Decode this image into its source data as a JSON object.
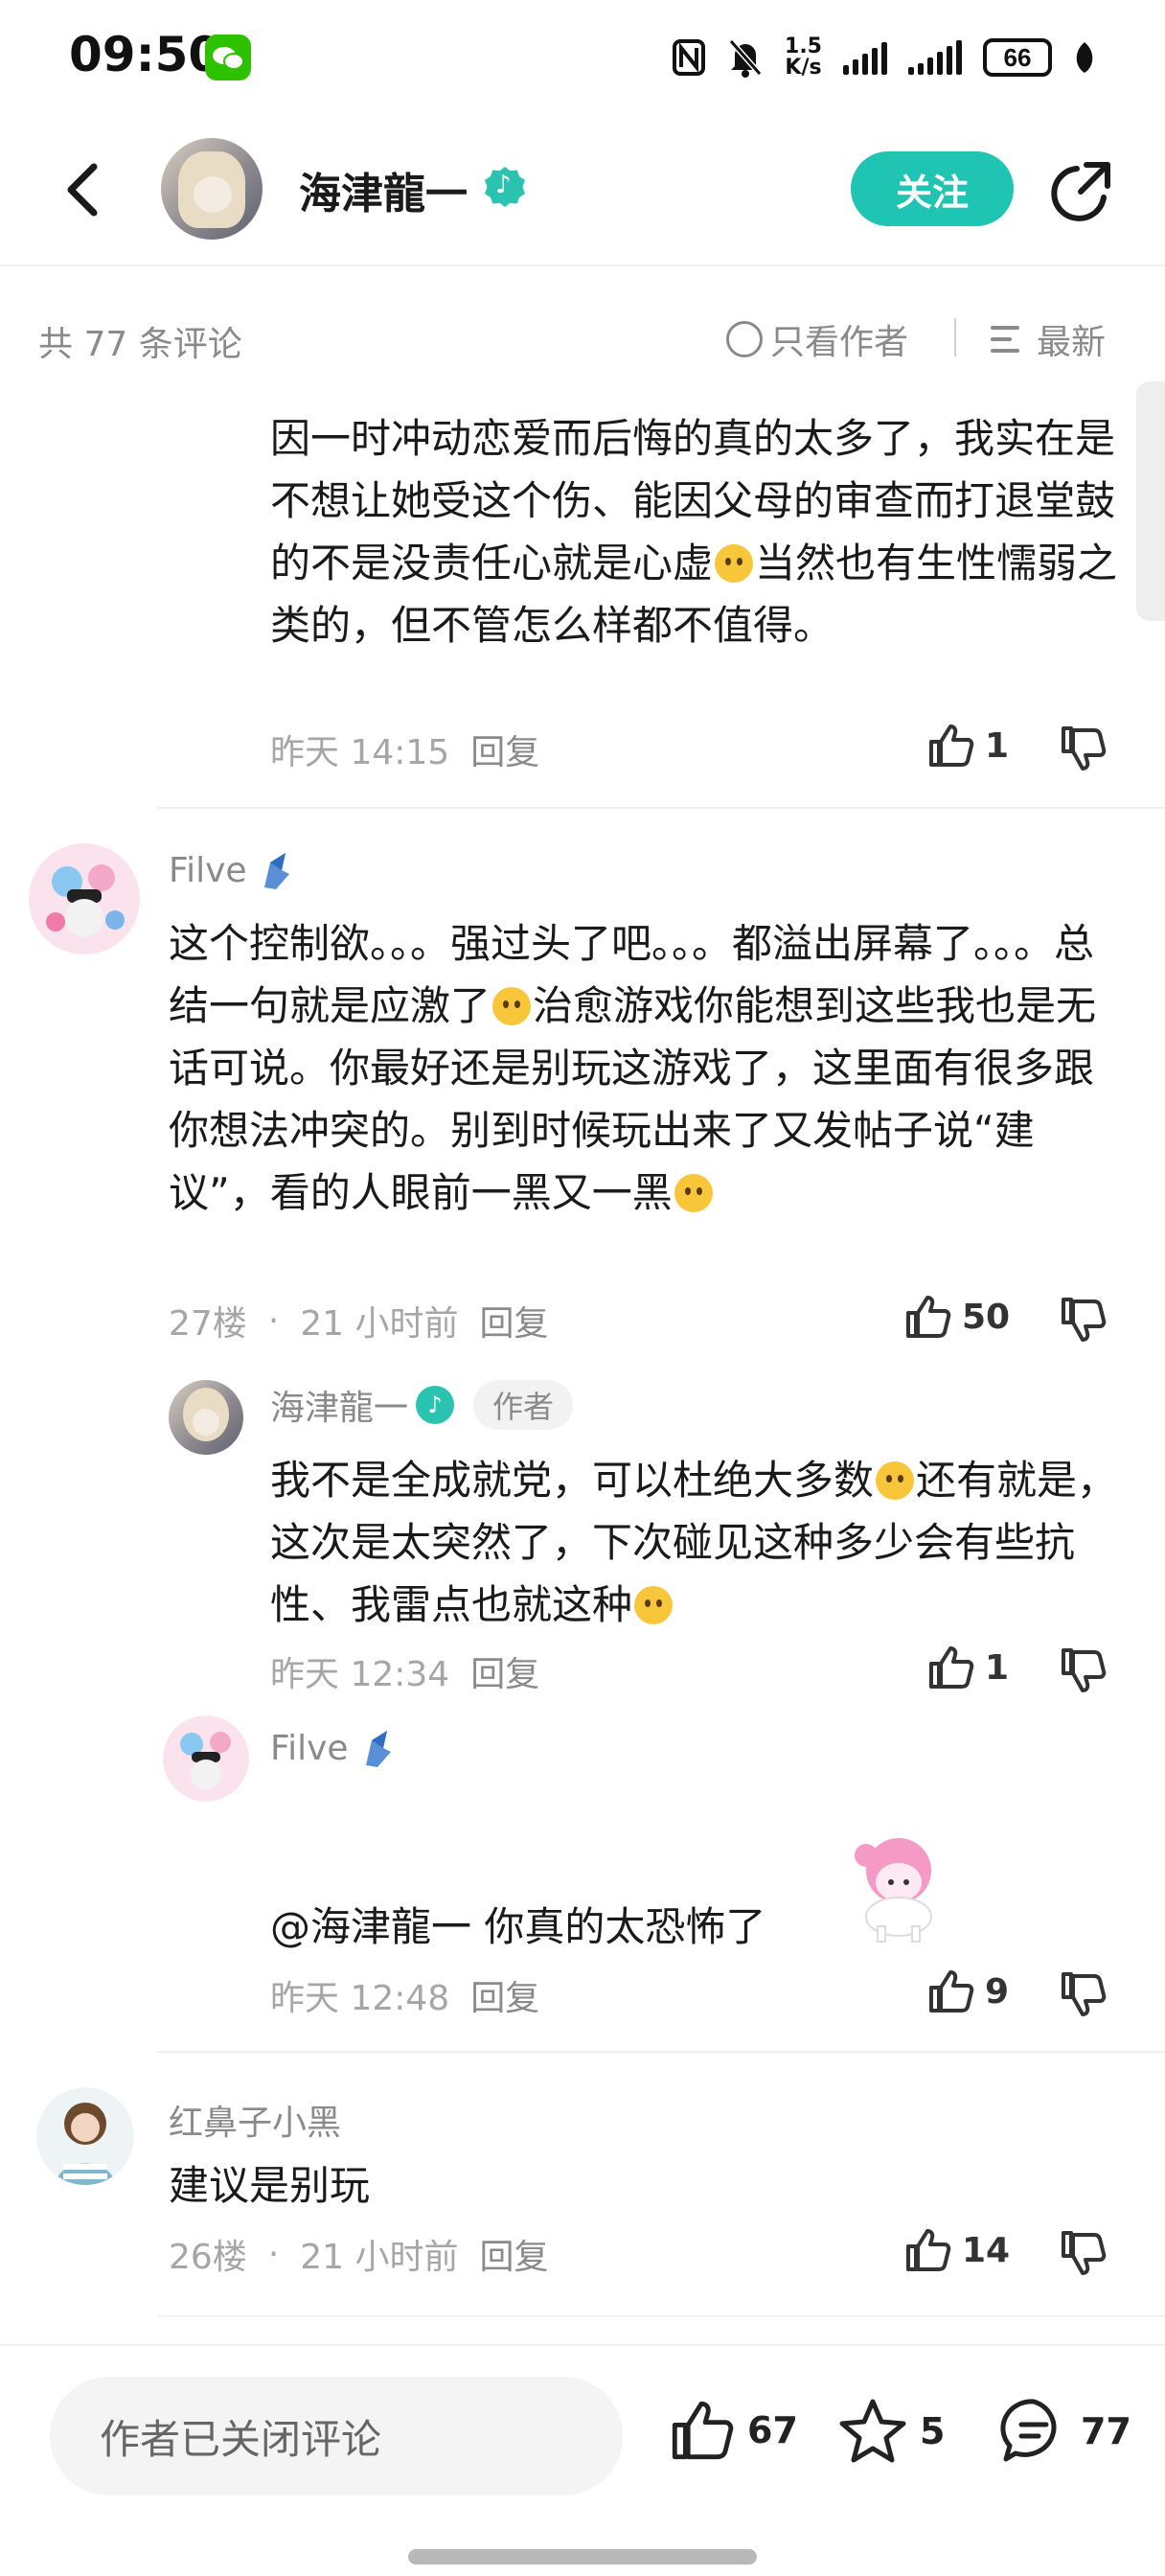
{
  "status_bar": {
    "time": "09:50",
    "net_speed_value": "1.5",
    "net_speed_unit": "K/s",
    "battery": "66"
  },
  "header": {
    "author_name": "海津龍一",
    "follow_label": "关注"
  },
  "sort_bar": {
    "count_text": "共 77 条评论",
    "author_only_label": "只看作者",
    "sort_label": "最新"
  },
  "comments": [
    {
      "text_a": "因一时冲动恋爱而后悔的真的太多了，我实在是不想让她受这个伤、能因父母的审查而打退堂鼓的不是没责任心就是心虚",
      "text_b": "当然也有生性懦弱之类的，但不管怎么样都不值得。",
      "time": "昨天 14:15",
      "reply_label": "回复",
      "likes": "1"
    },
    {
      "username": "Filve",
      "text_a": "这个控制欲。。。强过头了吧。。。都溢出屏幕了。。。总结一句就是应激了",
      "text_b": "治愈游戏你能想到这些我也是无话可说。你最好还是别玩这游戏了，这里面有很多跟你想法冲突的。别到时候玩出来了又发帖子说“建议”，看的人眼前一黑又一黑",
      "floor": "27楼",
      "time": "21 小时前",
      "reply_label": "回复",
      "likes": "50",
      "replies": [
        {
          "username": "海津龍一",
          "tag": "作者",
          "text_a": "我不是全成就党，可以杜绝大多数",
          "text_b": "还有就是，这次是太突然了，下次碰见这种多少会有些抗性、我雷点也就这种",
          "time": "昨天 12:34",
          "reply_label": "回复",
          "likes": "1"
        },
        {
          "username": "Filve",
          "text": "@海津龍一  你真的太恐怖了",
          "time": "昨天 12:48",
          "reply_label": "回复",
          "likes": "9"
        }
      ]
    },
    {
      "username": "红鼻子小黑",
      "text": "建议是别玩",
      "floor": "26楼",
      "time": "21 小时前",
      "reply_label": "回复",
      "likes": "14"
    }
  ],
  "bottom_bar": {
    "input_placeholder": "作者已关闭评论",
    "like_count": "67",
    "star_count": "5",
    "comment_count": "77"
  },
  "colors": {
    "accent": "#1fc4b3",
    "muted_text": "#8a8a8a",
    "verify_badge": "#2ac3b0"
  },
  "icons": [
    "back-icon",
    "share-icon",
    "thumb-up-icon",
    "thumb-down-icon",
    "star-icon",
    "comment-icon",
    "verify-badge-icon",
    "wechat-icon",
    "nfc-icon",
    "mute-icon"
  ]
}
